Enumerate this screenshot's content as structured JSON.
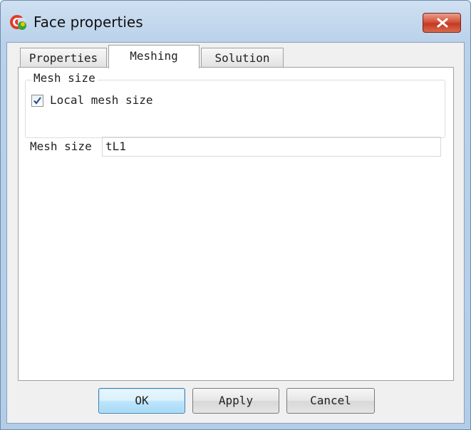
{
  "window": {
    "title": "Face properties",
    "icon": "app-logo-icon",
    "close_icon": "close-icon",
    "close_color": "#c83b22"
  },
  "tabs": [
    {
      "label": "Properties",
      "active": false
    },
    {
      "label": "Meshing",
      "active": true
    },
    {
      "label": "Solution",
      "active": false
    }
  ],
  "meshing": {
    "group_title": "Mesh size",
    "local_mesh": {
      "label": "Local mesh size",
      "checked": true
    },
    "mesh_size": {
      "label": "Mesh size",
      "value": "tL1"
    }
  },
  "buttons": {
    "ok": "OK",
    "apply": "Apply",
    "cancel": "Cancel"
  }
}
